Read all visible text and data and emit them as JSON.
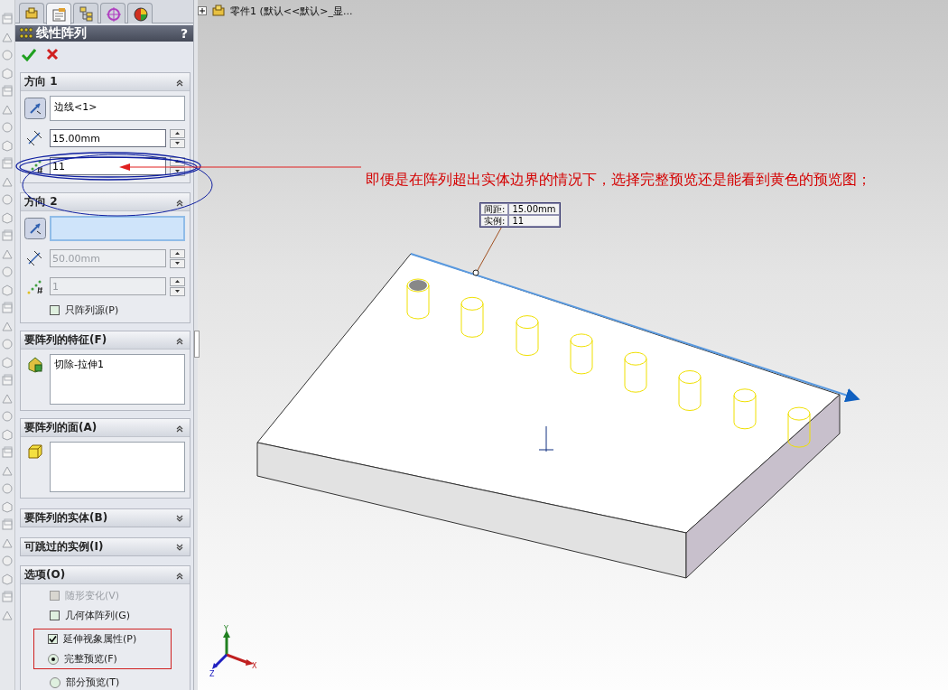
{
  "tree": {
    "label": "零件1 (默认<<默认>_显..."
  },
  "tabs": [
    {
      "kind": "feature-tree",
      "selected": false
    },
    {
      "kind": "property",
      "selected": true
    },
    {
      "kind": "config",
      "selected": false
    },
    {
      "kind": "dimxpert",
      "selected": false
    },
    {
      "kind": "display",
      "selected": false
    }
  ],
  "feature": {
    "title": "线性阵列",
    "help": "?"
  },
  "sections": [
    {
      "kind": "direction",
      "title": "方向 1",
      "expanded": true,
      "edge": {
        "value": "边线<1>",
        "focused": false
      },
      "spacing": {
        "value": "15.00mm",
        "disabled": false
      },
      "instances": {
        "value": "11",
        "disabled": false
      }
    },
    {
      "kind": "direction",
      "title": "方向 2",
      "expanded": true,
      "edge": {
        "focused": true
      },
      "spacing": {
        "value": "50.00mm",
        "disabled": true
      },
      "instances": {
        "value": "1",
        "disabled": true
      },
      "seed_only": {
        "label": "只阵列源(P)",
        "checked": false
      }
    },
    {
      "kind": "features",
      "title": "要阵列的特征(F)",
      "expanded": true,
      "items": [
        "切除-拉伸1"
      ]
    },
    {
      "kind": "faces",
      "title": "要阵列的面(A)",
      "expanded": true
    },
    {
      "kind": "bodies",
      "title": "要阵列的实体(B)",
      "expanded": false
    },
    {
      "kind": "skipped",
      "title": "可跳过的实例(I)",
      "expanded": false
    },
    {
      "kind": "options",
      "title": "选项(O)",
      "expanded": true,
      "items": [
        {
          "kind": "checkbox",
          "label": "随形变化(V)",
          "checked": false,
          "disabled": true
        },
        {
          "kind": "checkbox",
          "label": "几何体阵列(G)",
          "checked": false,
          "disabled": false
        },
        {
          "kind": "checkbox",
          "label": "延伸视象属性(P)",
          "checked": true,
          "disabled": false
        },
        {
          "kind": "radio",
          "label": "完整预览(F)",
          "selected": true
        },
        {
          "kind": "radio",
          "label": "部分预览(T)",
          "selected": false
        }
      ]
    }
  ],
  "axes": {
    "x": "X",
    "y": "Y",
    "z": "Z"
  },
  "annotation": {
    "text": "即便是在阵列超出实体边界的情况下，选择完整预览还是能看到黄色的预览图；"
  },
  "preview_tag": {
    "rows": [
      {
        "label": "间距:",
        "value": "15.00mm"
      },
      {
        "label": "实例:",
        "value": "11"
      }
    ]
  }
}
